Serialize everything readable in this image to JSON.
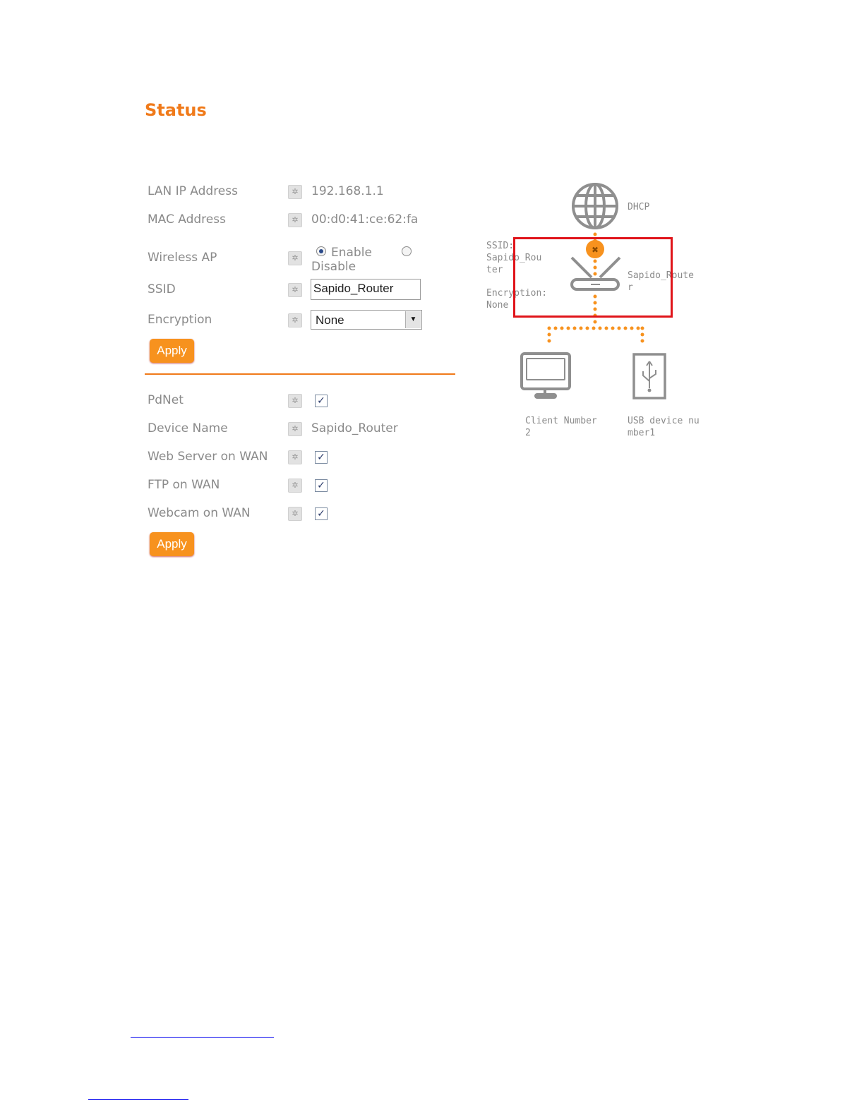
{
  "page": {
    "title": "Status"
  },
  "wireless": {
    "lan_ip_label": "LAN IP Address",
    "lan_ip_value": "192.168.1.1",
    "mac_label": "MAC Address",
    "mac_value": "00:d0:41:ce:62:fa",
    "ap_label": "Wireless AP",
    "ap_enable": "Enable",
    "ap_disable": "Disable",
    "ap_selected": "Enable",
    "ssid_label": "SSID",
    "ssid_value": "Sapido_Router",
    "encryption_label": "Encryption",
    "encryption_value": "None",
    "apply_label": "Apply"
  },
  "services": {
    "pdnet_label": "PdNet",
    "pdnet_checked": true,
    "device_name_label": "Device Name",
    "device_name_value": "Sapido_Router",
    "web_label": "Web Server on WAN",
    "web_checked": true,
    "ftp_label": "FTP on WAN",
    "ftp_checked": true,
    "webcam_label": "Webcam on WAN",
    "webcam_checked": true,
    "apply_label": "Apply"
  },
  "diagram": {
    "internet_label": "DHCP",
    "ssid_lines": [
      "SSID:",
      "Sapido_Rou",
      "ter"
    ],
    "enc_lines": [
      "Encryption:",
      "None"
    ],
    "router_lines": [
      "Sapido_Route",
      "r"
    ],
    "client_lines": [
      "Client Number",
      "2"
    ],
    "usb_lines": [
      "USB device nu",
      "mber1"
    ]
  },
  "colors": {
    "accent": "#f07a1a",
    "button": "#f7921e",
    "highlight": "#e0141a"
  }
}
